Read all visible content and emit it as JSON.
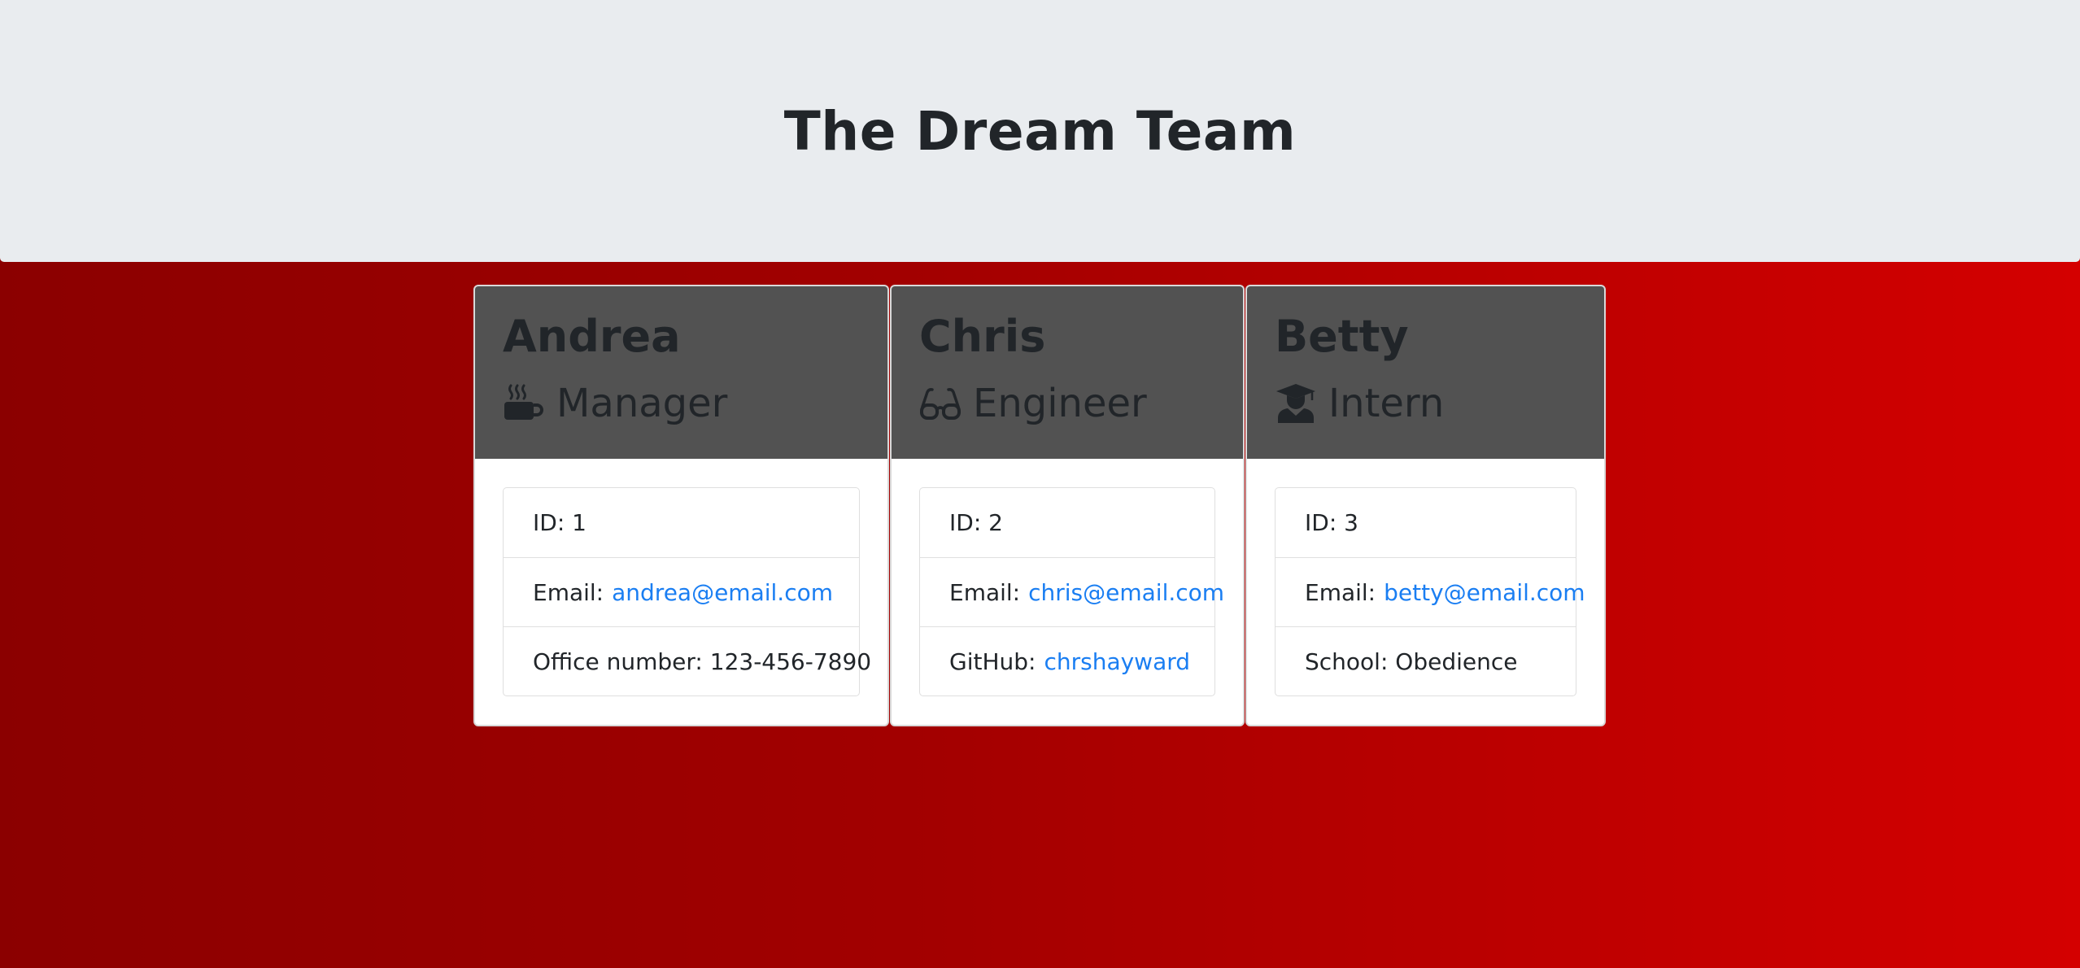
{
  "header": {
    "title": "The Dream Team"
  },
  "employees": [
    {
      "name": "Andrea",
      "role": "Manager",
      "icon": "coffee-mug-icon",
      "id_text": "ID: 1",
      "email_label": "Email:",
      "email": "andrea@email.com",
      "extra_text": "Office number: 123-456-7890"
    },
    {
      "name": "Chris",
      "role": "Engineer",
      "icon": "glasses-icon",
      "id_text": "ID: 2",
      "email_label": "Email:",
      "email": "chris@email.com",
      "extra_label": "GitHub:",
      "extra_link": "chrshayward"
    },
    {
      "name": "Betty",
      "role": "Intern",
      "icon": "graduate-icon",
      "id_text": "ID: 3",
      "email_label": "Email:",
      "email": "betty@email.com",
      "extra_text": "School: Obedience"
    }
  ],
  "colors": {
    "background_start": "#8b0000",
    "background_end": "#d40000",
    "jumbotron": "#e9ecef",
    "card_header": "#525252",
    "link": "#1a7ef2"
  }
}
